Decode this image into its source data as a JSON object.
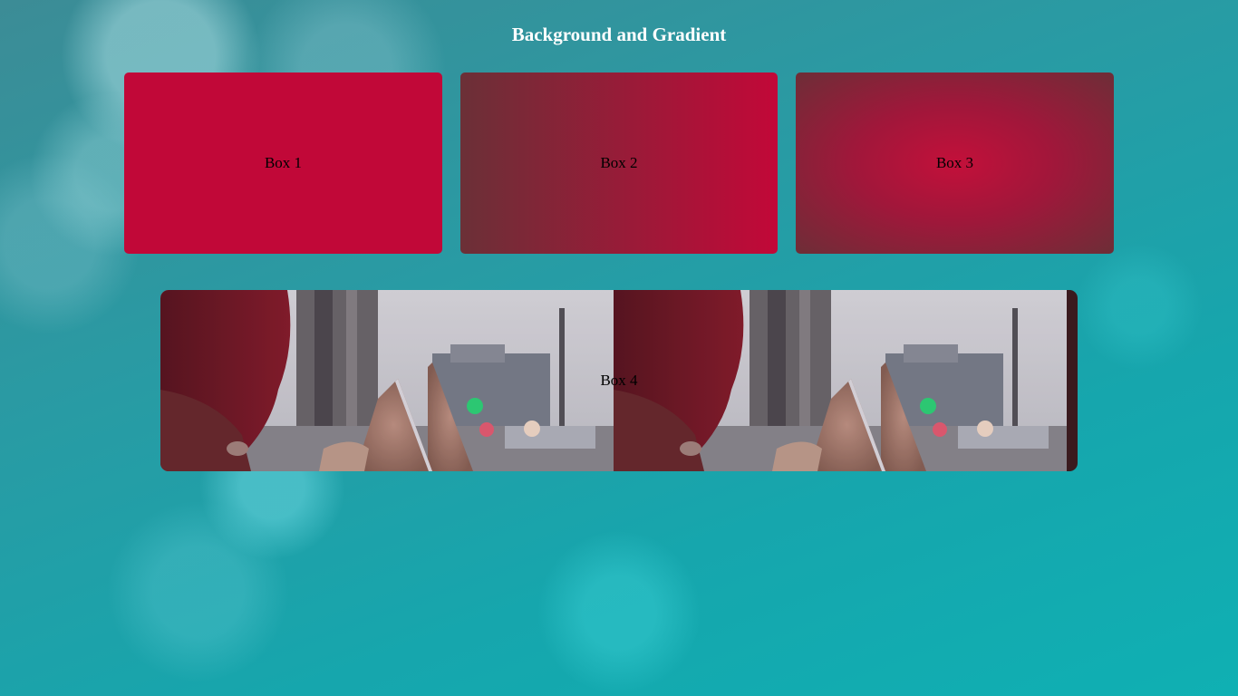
{
  "page": {
    "title": "Background and Gradient"
  },
  "boxes": [
    {
      "label": "Box 1",
      "color": "#c10838"
    },
    {
      "label": "Box 2",
      "gradient_from": "#6b3037",
      "gradient_to": "#c20838"
    },
    {
      "label": "Box 3",
      "gradient_center": "#c3103a",
      "gradient_edge": "#6d2e37"
    },
    {
      "label": "Box 4",
      "background": "repeating photo: person holding broken mirror shard"
    }
  ],
  "colors": {
    "page_background": "#16a6ad",
    "title_text": "#ffffff"
  }
}
